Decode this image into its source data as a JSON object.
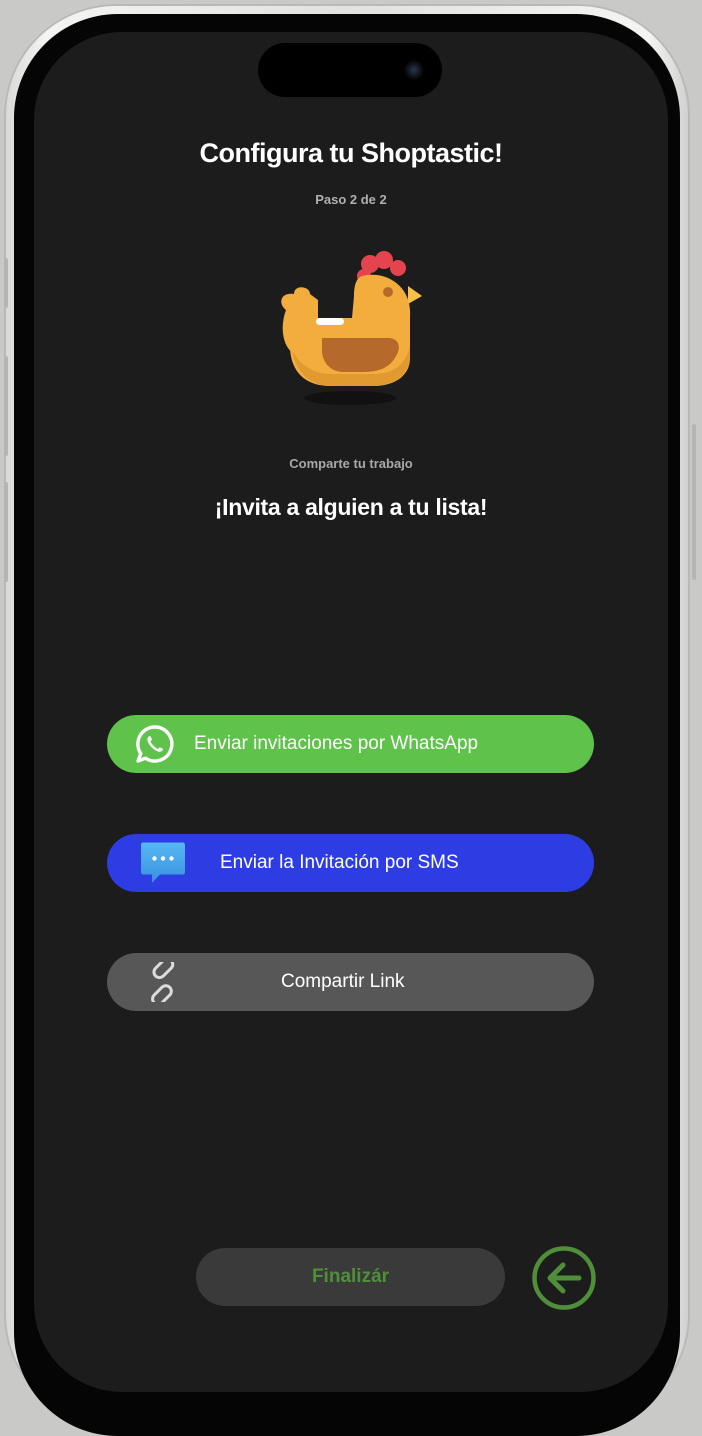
{
  "header": {
    "title": "Configura tu Shoptastic!",
    "step": "Paso 2 de 2"
  },
  "mascot": {
    "icon": "chicken-icon"
  },
  "content": {
    "caption": "Comparte tu trabajo",
    "headline": "¡Invita a alguien a tu lista!"
  },
  "share": {
    "whatsapp": {
      "label": "Enviar invitaciones por WhatsApp",
      "icon": "whatsapp-icon",
      "color": "#5ec24b"
    },
    "sms": {
      "label": "Enviar la Invitación por SMS",
      "icon": "message-bubble-icon",
      "color": "#2e3de3"
    },
    "link": {
      "label": "Compartir Link",
      "icon": "chain-link-icon",
      "color": "#575757"
    }
  },
  "footer": {
    "finish_label": "Finalizár",
    "back_icon": "arrow-left-circle-icon",
    "accent": "#4f8f3a"
  }
}
